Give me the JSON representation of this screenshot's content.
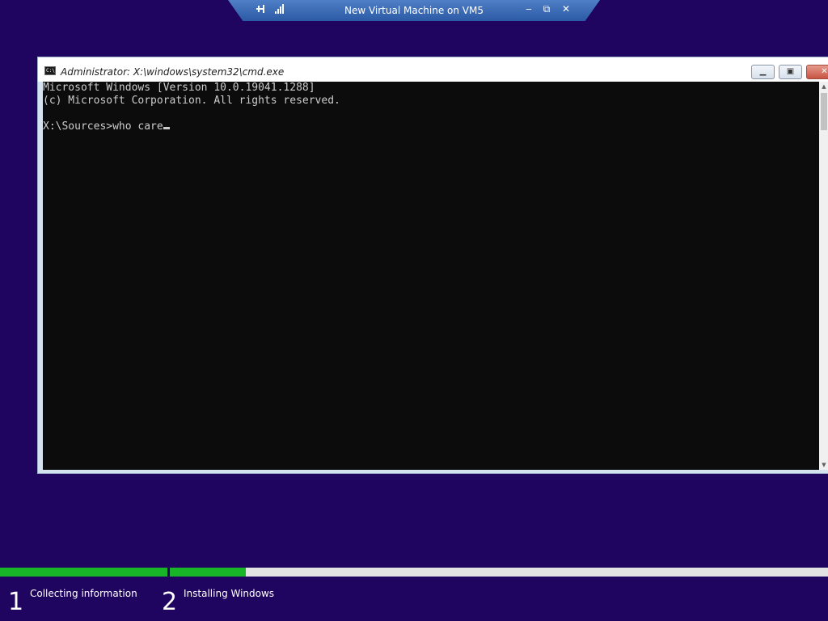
{
  "remote_bar": {
    "title": "New Virtual Machine on VM5",
    "pin_icon": "pin-icon",
    "signal_icon": "signal-strength-icon",
    "minimize_glyph": "‒",
    "restore_glyph": "⧉",
    "close_glyph": "✕"
  },
  "window": {
    "title": "Administrator: X:\\windows\\system32\\cmd.exe",
    "app_icon_text": "C:\\",
    "minimize_glyph": "▁",
    "maximize_glyph": "▣",
    "close_glyph": "✕"
  },
  "console": {
    "lines": [
      "Microsoft Windows [Version 10.0.19041.1288]",
      "(c) Microsoft Corporation. All rights reserved.",
      "",
      "X:\\Sources>who care"
    ]
  },
  "scrollbar": {
    "up_glyph": "▲",
    "down_glyph": "▼"
  },
  "setup": {
    "steps": [
      {
        "number": "1",
        "label": "Collecting information",
        "progress": 1.0
      },
      {
        "number": "2",
        "label": "Installing Windows",
        "progress": 0.115
      }
    ]
  },
  "colors": {
    "desktop_bg": "#1f0560",
    "console_bg": "#0c0c0c",
    "console_text": "#cccccc",
    "progress_fill": "#18b528",
    "progress_track": "#e3e3e3"
  }
}
